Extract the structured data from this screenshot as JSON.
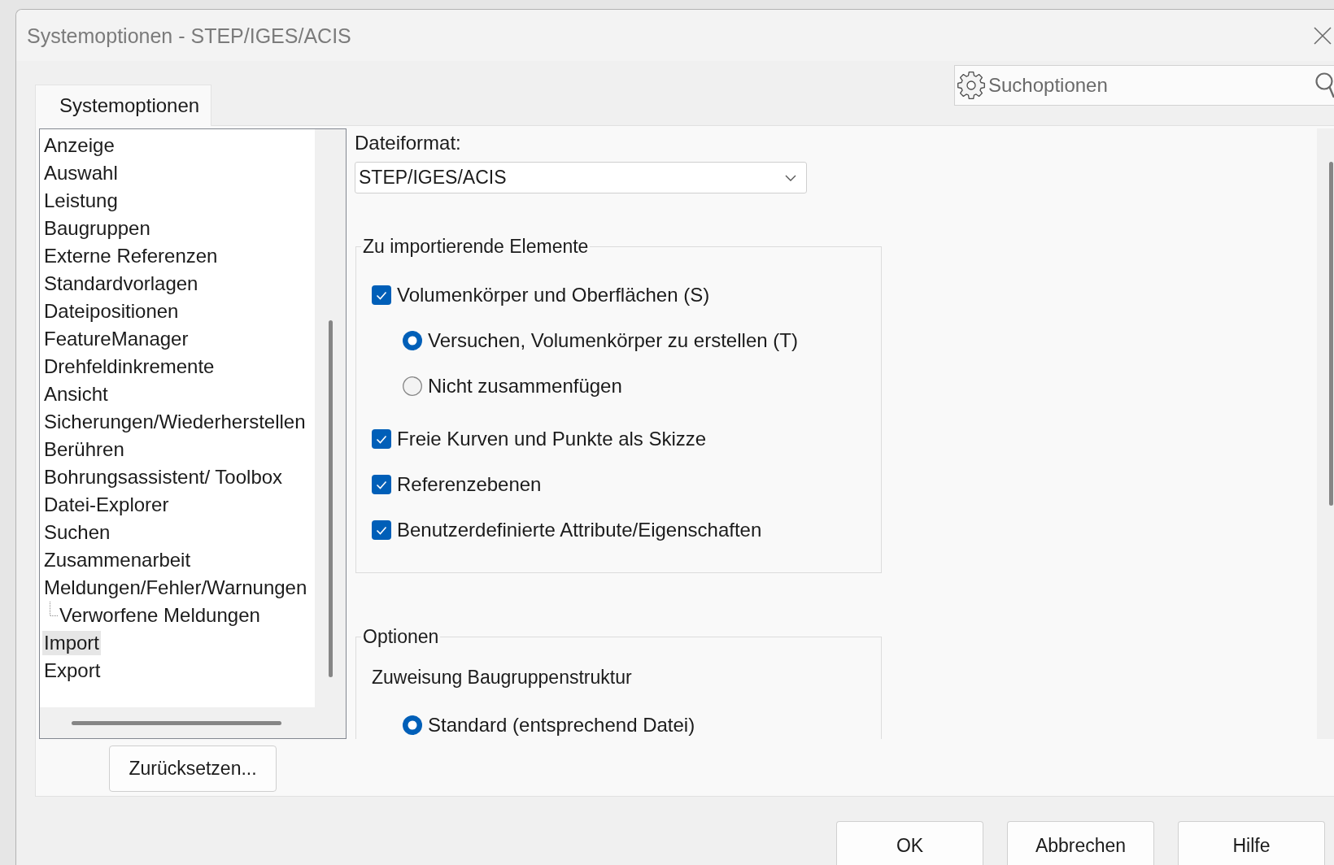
{
  "window": {
    "title": "Systemoptionen - STEP/IGES/ACIS"
  },
  "tabs": [
    {
      "label": "Systemoptionen",
      "selected": true
    }
  ],
  "search": {
    "placeholder": "Suchoptionen"
  },
  "sidebar": {
    "items": [
      {
        "label": "Anzeige",
        "selected": false
      },
      {
        "label": "Auswahl",
        "selected": false
      },
      {
        "label": "Leistung",
        "selected": false
      },
      {
        "label": "Baugruppen",
        "selected": false
      },
      {
        "label": "Externe Referenzen",
        "selected": false
      },
      {
        "label": "Standardvorlagen",
        "selected": false
      },
      {
        "label": "Dateipositionen",
        "selected": false
      },
      {
        "label": "FeatureManager",
        "selected": false
      },
      {
        "label": "Drehfeldinkremente",
        "selected": false
      },
      {
        "label": "Ansicht",
        "selected": false
      },
      {
        "label": "Sicherungen/Wiederherstellen",
        "selected": false
      },
      {
        "label": "Berühren",
        "selected": false
      },
      {
        "label": "Bohrungsassistent/ Toolbox",
        "selected": false
      },
      {
        "label": "Datei-Explorer",
        "selected": false
      },
      {
        "label": "Suchen",
        "selected": false
      },
      {
        "label": "Zusammenarbeit",
        "selected": false
      },
      {
        "label": "Meldungen/Fehler/Warnungen",
        "selected": false,
        "children": [
          {
            "label": "Verworfene Meldungen",
            "selected": false
          }
        ]
      },
      {
        "label": "Import",
        "selected": true
      },
      {
        "label": "Export",
        "selected": false
      }
    ]
  },
  "reset_button": "Zurücksetzen...",
  "file_format": {
    "label": "Dateiformat:",
    "value": "STEP/IGES/ACIS"
  },
  "groups": [
    {
      "title": "Zu importierende Elemente",
      "items": [
        {
          "kind": "checkbox",
          "label": "Volumenkörper und Oberflächen (S)",
          "checked": true
        },
        {
          "kind": "radio",
          "label": "Versuchen, Volumenkörper zu erstellen (T)",
          "selected": true
        },
        {
          "kind": "radio",
          "label": "Nicht zusammenfügen",
          "selected": false
        },
        {
          "kind": "checkbox",
          "label": "Freie Kurven und Punkte als Skizze",
          "checked": true
        },
        {
          "kind": "checkbox",
          "label": "Referenzebenen",
          "checked": true
        },
        {
          "kind": "checkbox",
          "label": "Benutzerdefinierte Attribute/Eigenschaften",
          "checked": true
        }
      ]
    },
    {
      "title": "Optionen",
      "items": [
        {
          "kind": "heading",
          "label": "Zuweisung Baugruppenstruktur"
        },
        {
          "kind": "radio",
          "label": "Standard (entsprechend Datei)",
          "selected": true
        }
      ]
    }
  ],
  "buttons": [
    "OK",
    "Abbrechen",
    "Hilfe"
  ]
}
